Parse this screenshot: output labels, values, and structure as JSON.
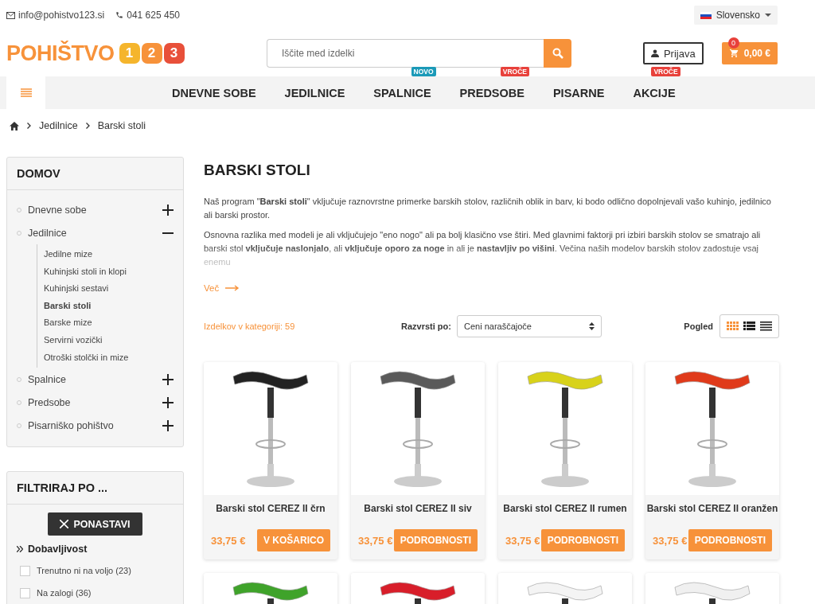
{
  "topbar": {
    "email": "info@pohistvo123.si",
    "phone": "041 625 450",
    "language": "Slovensko"
  },
  "header": {
    "logo_text": "POHIŠTVO",
    "logo_digits": [
      "1",
      "2",
      "3"
    ],
    "search": {
      "placeholder": "Iščite med izdelki"
    },
    "login": "Prijava",
    "cart": {
      "count": "0",
      "total": "0,00 €"
    }
  },
  "nav": [
    {
      "label": "DNEVNE SOBE"
    },
    {
      "label": "JEDILNICE"
    },
    {
      "label": "SPALNICE",
      "badge": {
        "label": "NOVO",
        "kind": "new"
      }
    },
    {
      "label": "PREDSOBE",
      "badge": {
        "label": "VROČE",
        "kind": "hot"
      }
    },
    {
      "label": "PISARNE"
    },
    {
      "label": "AKCIJE",
      "badge": {
        "label": "VROČE",
        "kind": "hot"
      }
    }
  ],
  "breadcrumb": [
    "Jedilnice",
    "Barski stoli"
  ],
  "categories": {
    "title": "DOMOV",
    "items": [
      {
        "label": "Dnevne sobe",
        "expanded": false
      },
      {
        "label": "Jedilnice",
        "expanded": true,
        "children": [
          {
            "label": "Jedilne mize",
            "selected": false
          },
          {
            "label": "Kuhinjski stoli in klopi",
            "selected": false
          },
          {
            "label": "Kuhinjski sestavi",
            "selected": false
          },
          {
            "label": "Barski stoli",
            "selected": true
          },
          {
            "label": "Barske mize",
            "selected": false
          },
          {
            "label": "Servirni vozički",
            "selected": false
          },
          {
            "label": "Otroški stolčki in mize",
            "selected": false
          }
        ]
      },
      {
        "label": "Spalnice",
        "expanded": false
      },
      {
        "label": "Predsobe",
        "expanded": false
      },
      {
        "label": "Pisarniško pohištvo",
        "expanded": false
      }
    ]
  },
  "filter": {
    "title": "FILTRIRAJ PO ...",
    "reset": "PONASTAVI",
    "group": "Dobavljivost",
    "options": [
      {
        "label": "Trenutno ni na voljo (23)",
        "checked": false
      },
      {
        "label": "Na zalogi (36)",
        "checked": false
      }
    ]
  },
  "page": {
    "title": "BARSKI STOLI",
    "paragraphs": [
      "Naš program \"**Barski stoli**\" vključuje raznovrstne primerke barskih stolov, različnih oblik in barv, ki bodo odlično dopolnjevali vašo kuhinjo, jedilnico ali barski prostor.",
      "Osnovna razlika med modeli je ali vključujejo \"eno nogo\" ali pa bolj klasično vse štiri. Med glavnimi faktorji pri izbiri barskih stolov se smatrajo ali barski stol **vključuje naslonjalo**, ali **vključuje oporo za noge** in ali je **nastavljiv po višini**. Večina naših modelov barskih stolov zadostuje vsaj enemu"
    ],
    "more": "Več"
  },
  "toolbar": {
    "count": "Izdelkov v kategoriji: 59",
    "sort_label": "Razvrsti po:",
    "sort_value": "Ceni naraščajoče",
    "view_label": "Pogled",
    "views": [
      {
        "kind": "grid",
        "selected": true
      },
      {
        "kind": "list",
        "selected": false
      },
      {
        "kind": "compact",
        "selected": false
      }
    ]
  },
  "products": [
    {
      "name": "Barski stol CEREZ II črn",
      "price": "33,75 €",
      "action": "V KOŠARICO",
      "color": "#222222"
    },
    {
      "name": "Barski stol CEREZ II siv",
      "price": "33,75 €",
      "action": "PODROBNOSTI",
      "color": "#5a5a5a"
    },
    {
      "name": "Barski stol CEREZ II rumen",
      "price": "33,75 €",
      "action": "PODROBNOSTI",
      "color": "#d8d21a"
    },
    {
      "name": "Barski stol CEREZ II oranžen",
      "price": "33,75 €",
      "action": "PODROBNOSTI",
      "color": "#e03a1a"
    },
    {
      "color": "#3fa32a"
    },
    {
      "color": "#d81e2a"
    },
    {
      "color": "#f4f4f4"
    },
    {
      "color": "#f0f0f0"
    }
  ]
}
